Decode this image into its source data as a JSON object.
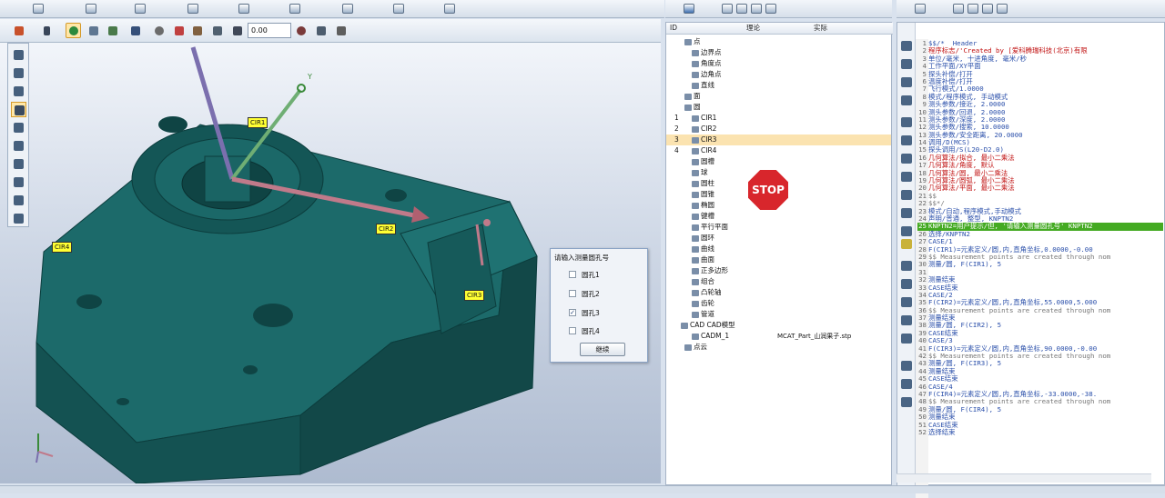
{
  "toolbar": {
    "zoom_value": "0.00"
  },
  "viewport": {
    "labels": [
      "CIR1",
      "CIR2",
      "CIR3",
      "CIR4"
    ],
    "axis_y": "Y"
  },
  "dialog": {
    "title": "请输入测量圆孔号",
    "options": [
      {
        "label": "圆孔1",
        "checked": false
      },
      {
        "label": "圆孔2",
        "checked": false
      },
      {
        "label": "圆孔3",
        "checked": true
      },
      {
        "label": "圆孔4",
        "checked": false
      }
    ],
    "continue_label": "继续"
  },
  "stop_sign": "STOP",
  "tree": {
    "columns": {
      "id": "ID",
      "theory": "理论",
      "actual": "实际"
    },
    "rows": [
      {
        "id": "",
        "name": "点",
        "indent": 24,
        "actual": ""
      },
      {
        "id": "",
        "name": "边界点",
        "indent": 32,
        "actual": ""
      },
      {
        "id": "",
        "name": "角度点",
        "indent": 32,
        "actual": ""
      },
      {
        "id": "",
        "name": "边角点",
        "indent": 32,
        "actual": ""
      },
      {
        "id": "",
        "name": "直线",
        "indent": 32,
        "actual": ""
      },
      {
        "id": "",
        "name": "面",
        "indent": 24,
        "actual": ""
      },
      {
        "id": "",
        "name": "圆",
        "indent": 24,
        "actual": ""
      },
      {
        "id": "1",
        "name": "CIR1",
        "indent": 32,
        "actual": ""
      },
      {
        "id": "2",
        "name": "CIR2",
        "indent": 32,
        "actual": ""
      },
      {
        "id": "3",
        "name": "CIR3",
        "indent": 32,
        "actual": "",
        "selected": true
      },
      {
        "id": "4",
        "name": "CIR4",
        "indent": 32,
        "actual": ""
      },
      {
        "id": "",
        "name": "圆槽",
        "indent": 32,
        "actual": ""
      },
      {
        "id": "",
        "name": "球",
        "indent": 32,
        "actual": ""
      },
      {
        "id": "",
        "name": "圆柱",
        "indent": 32,
        "actual": ""
      },
      {
        "id": "",
        "name": "圆锥",
        "indent": 32,
        "actual": ""
      },
      {
        "id": "",
        "name": "椭圆",
        "indent": 32,
        "actual": ""
      },
      {
        "id": "",
        "name": "键槽",
        "indent": 32,
        "actual": ""
      },
      {
        "id": "",
        "name": "平行平面",
        "indent": 32,
        "actual": ""
      },
      {
        "id": "",
        "name": "圆环",
        "indent": 32,
        "actual": ""
      },
      {
        "id": "",
        "name": "曲线",
        "indent": 32,
        "actual": ""
      },
      {
        "id": "",
        "name": "曲面",
        "indent": 32,
        "actual": ""
      },
      {
        "id": "",
        "name": "正多边形",
        "indent": 32,
        "actual": ""
      },
      {
        "id": "",
        "name": "组合",
        "indent": 32,
        "actual": ""
      },
      {
        "id": "",
        "name": "凸轮轴",
        "indent": 32,
        "actual": ""
      },
      {
        "id": "",
        "name": "齿轮",
        "indent": 32,
        "actual": ""
      },
      {
        "id": "",
        "name": "管道",
        "indent": 32,
        "actual": ""
      },
      {
        "id": "",
        "name": "CAD模型",
        "indent": 20,
        "actual": "",
        "prefix": "CAD"
      },
      {
        "id": "",
        "name": "CADM_1",
        "indent": 32,
        "actual": "MCAT_Part_山润果子.stp"
      },
      {
        "id": "",
        "name": "点云",
        "indent": 24,
        "actual": ""
      }
    ]
  },
  "code": {
    "lines": [
      {
        "n": "1",
        "t": "$$/*  Header",
        "c": "#2a4faa"
      },
      {
        "n": "2",
        "t": "程序标志/'Created by [爱科腾瑞科技(北京)有限",
        "c": "#c01010"
      },
      {
        "n": "3",
        "t": "单位/毫米, 十进角度, 毫米/秒",
        "c": "#2a4faa"
      },
      {
        "n": "4",
        "t": "工作平面/XY平面",
        "c": "#2a4faa"
      },
      {
        "n": "5",
        "t": "探头补偿/打开",
        "c": "#2a4faa"
      },
      {
        "n": "6",
        "t": "温度补偿/打开",
        "c": "#2a4faa"
      },
      {
        "n": "7",
        "t": "飞行模式/1.0000",
        "c": "#2a4faa"
      },
      {
        "n": "8",
        "t": "模式/程序模式, 手动模式",
        "c": "#2a4faa"
      },
      {
        "n": "9",
        "t": "测头参数/接近, 2.0000",
        "c": "#2a4faa"
      },
      {
        "n": "10",
        "t": "测头参数/回退, 2.0000",
        "c": "#2a4faa"
      },
      {
        "n": "11",
        "t": "测头参数/深度, 2.0000",
        "c": "#2a4faa"
      },
      {
        "n": "12",
        "t": "测头参数/搜索, 10.0000",
        "c": "#2a4faa"
      },
      {
        "n": "13",
        "t": "测头参数/安全距离, 20.0000",
        "c": "#2a4faa"
      },
      {
        "n": "14",
        "t": "调用/D(MCS)",
        "c": "#2a4faa"
      },
      {
        "n": "15",
        "t": "探头调用/S(L20-D2.0)",
        "c": "#2a4faa"
      },
      {
        "n": "16",
        "t": "几何算法/拟合, 最小二乘法",
        "c": "#c01010"
      },
      {
        "n": "17",
        "t": "几何算法/角度, 默认",
        "c": "#c01010"
      },
      {
        "n": "18",
        "t": "几何算法/圆, 最小二乘法",
        "c": "#c01010"
      },
      {
        "n": "19",
        "t": "几何算法/圆弧, 最小二乘法",
        "c": "#c01010"
      },
      {
        "n": "20",
        "t": "几何算法/平面, 最小二乘法",
        "c": "#c01010"
      },
      {
        "n": "21",
        "t": "$$",
        "c": "#777"
      },
      {
        "n": "22",
        "t": "$$*/",
        "c": "#777"
      },
      {
        "n": "23",
        "t": "模式/自动,程序模式,手动模式",
        "c": "#2a4faa"
      },
      {
        "n": "24",
        "t": "声明/普通, 整型, KNPTN2",
        "c": "#2a4faa"
      },
      {
        "n": "25",
        "t": "KNPTN2=用户提示/但, '请输入测量圆孔号' KNPTN2",
        "c": "#ffffff",
        "hl": true
      },
      {
        "n": "26",
        "t": "选择/KNPTN2",
        "c": "#2a4faa"
      },
      {
        "n": "27",
        "t": "CASE/1",
        "c": "#2a4faa"
      },
      {
        "n": "28",
        "t": "F(CIR1)=元素定义/圆,内,直角坐标,0.0000,-0.00",
        "c": "#2a4faa"
      },
      {
        "n": "29",
        "t": "$$ Measurement points are created through nom",
        "c": "#777"
      },
      {
        "n": "30",
        "t": "测量/圆, F(CIR1), 5",
        "c": "#2a4faa"
      },
      {
        "n": "31",
        "t": "",
        "c": "#2a4faa"
      },
      {
        "n": "32",
        "t": "测量结束",
        "c": "#2a4faa"
      },
      {
        "n": "33",
        "t": "CASE结束",
        "c": "#2a4faa"
      },
      {
        "n": "34",
        "t": "CASE/2",
        "c": "#2a4faa"
      },
      {
        "n": "35",
        "t": "F(CIR2)=元素定义/圆,内,直角坐标,55.0000,5.000",
        "c": "#2a4faa"
      },
      {
        "n": "36",
        "t": "$$ Measurement points are created through nom",
        "c": "#777"
      },
      {
        "n": "37",
        "t": "测量结束",
        "c": "#2a4faa"
      },
      {
        "n": "38",
        "t": "测量/圆, F(CIR2), 5",
        "c": "#2a4faa"
      },
      {
        "n": "39",
        "t": "CASE结束",
        "c": "#2a4faa"
      },
      {
        "n": "40",
        "t": "CASE/3",
        "c": "#2a4faa"
      },
      {
        "n": "41",
        "t": "F(CIR3)=元素定义/圆,内,直角坐标,90.0000,-0.00",
        "c": "#2a4faa"
      },
      {
        "n": "42",
        "t": "$$ Measurement points are created through nom",
        "c": "#777"
      },
      {
        "n": "43",
        "t": "测量/圆, F(CIR3), 5",
        "c": "#2a4faa"
      },
      {
        "n": "44",
        "t": "测量结束",
        "c": "#2a4faa"
      },
      {
        "n": "45",
        "t": "CASE结束",
        "c": "#2a4faa"
      },
      {
        "n": "46",
        "t": "CASE/4",
        "c": "#2a4faa"
      },
      {
        "n": "47",
        "t": "F(CIR4)=元素定义/圆,内,直角坐标,-33.0000,-38.",
        "c": "#2a4faa"
      },
      {
        "n": "48",
        "t": "$$ Measurement points are created through nom",
        "c": "#777"
      },
      {
        "n": "49",
        "t": "测量/圆, F(CIR4), 5",
        "c": "#2a4faa"
      },
      {
        "n": "50",
        "t": "测量结束",
        "c": "#2a4faa"
      },
      {
        "n": "51",
        "t": "CASE结束",
        "c": "#2a4faa"
      },
      {
        "n": "52",
        "t": "选择结束",
        "c": "#2a4faa"
      }
    ]
  }
}
